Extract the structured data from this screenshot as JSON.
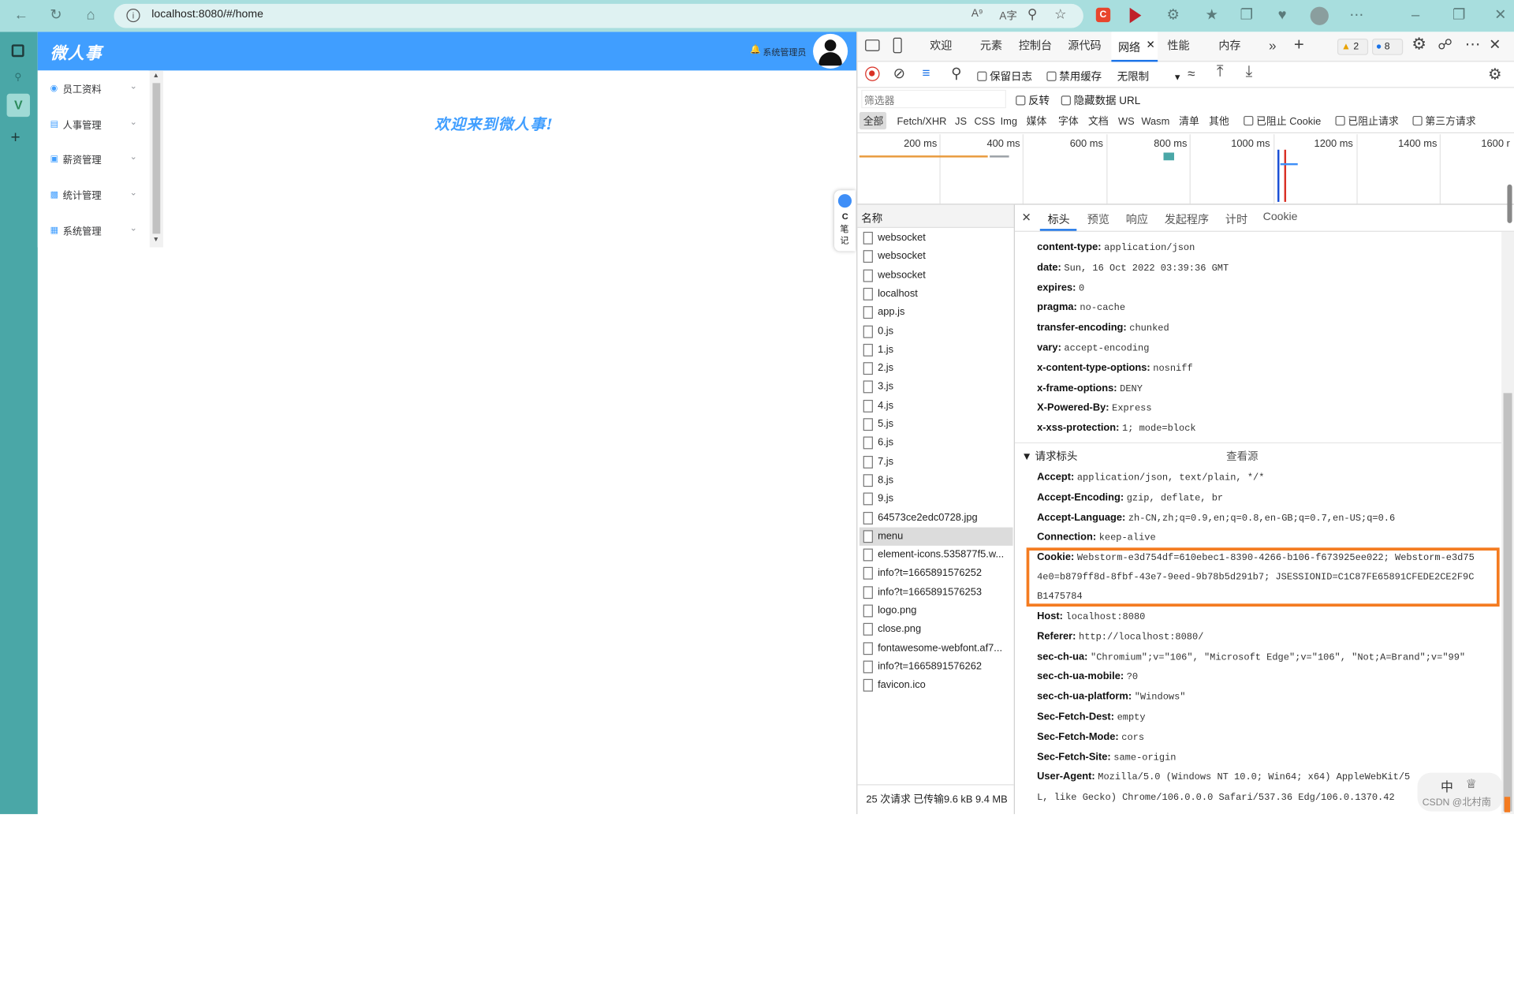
{
  "browser": {
    "url": "localhost:8080/#/home",
    "reader_label": "A⁹",
    "translate_label": "A字",
    "ext_c_label": "C"
  },
  "app": {
    "logo": "微人事",
    "user_name": "系统管理员",
    "welcome": "欢迎来到微人事!",
    "menu": [
      {
        "label": "员工资料",
        "icon": "user-icon"
      },
      {
        "label": "人事管理",
        "icon": "id-card-icon"
      },
      {
        "label": "薪资管理",
        "icon": "money-icon"
      },
      {
        "label": "统计管理",
        "icon": "bar-chart-icon"
      },
      {
        "label": "系统管理",
        "icon": "windows-icon"
      }
    ],
    "csdn_note": {
      "c": "C",
      "line1": "笔",
      "line2": "记"
    }
  },
  "devtools": {
    "tabs": [
      "欢迎",
      "元素",
      "控制台",
      "源代码",
      "网络",
      "性能",
      "内存"
    ],
    "active_tab": "网络",
    "warnings": "2",
    "messages": "8",
    "toolbar": {
      "preserve_log": "保留日志",
      "disable_cache": "禁用缓存",
      "throttle": "无限制"
    },
    "filter": {
      "placeholder": "筛选器",
      "invert": "反转",
      "hide_data_url": "隐藏数据 URL"
    },
    "types": [
      "全部",
      "Fetch/XHR",
      "JS",
      "CSS",
      "Img",
      "媒体",
      "字体",
      "文档",
      "WS",
      "Wasm",
      "清单",
      "其他"
    ],
    "blocked_cookies": "已阻止 Cookie",
    "blocked_requests": "已阻止请求",
    "third_party": "第三方请求",
    "timeline_labels": [
      "200 ms",
      "400 ms",
      "600 ms",
      "800 ms",
      "1000 ms",
      "1200 ms",
      "1400 ms",
      "1600 r"
    ],
    "name_header": "名称",
    "requests": [
      "websocket",
      "websocket",
      "websocket",
      "localhost",
      "app.js",
      "0.js",
      "1.js",
      "2.js",
      "3.js",
      "4.js",
      "5.js",
      "6.js",
      "7.js",
      "8.js",
      "9.js",
      "64573ce2edc0728.jpg",
      "menu",
      "element-icons.535877f5.w...",
      "info?t=1665891576252",
      "info?t=1665891576253",
      "logo.png",
      "close.png",
      "fontawesome-webfont.af7...",
      "info?t=1665891576262",
      "favicon.ico"
    ],
    "selected_request": "menu",
    "status_bar": "25 次请求  已传输9.6 kB  9.4 MB",
    "detail_tabs": [
      "标头",
      "预览",
      "响应",
      "发起程序",
      "计时",
      "Cookie"
    ],
    "active_detail_tab": "标头",
    "response_headers": [
      {
        "k": "content-type:",
        "v": "application/json"
      },
      {
        "k": "date:",
        "v": "Sun, 16 Oct 2022 03:39:36 GMT"
      },
      {
        "k": "expires:",
        "v": "0"
      },
      {
        "k": "pragma:",
        "v": "no-cache"
      },
      {
        "k": "transfer-encoding:",
        "v": "chunked"
      },
      {
        "k": "vary:",
        "v": "accept-encoding"
      },
      {
        "k": "x-content-type-options:",
        "v": "nosniff"
      },
      {
        "k": "x-frame-options:",
        "v": "DENY"
      },
      {
        "k": "X-Powered-By:",
        "v": "Express"
      },
      {
        "k": "x-xss-protection:",
        "v": "1; mode=block"
      }
    ],
    "request_section": "▼ 请求标头",
    "view_source": "查看源",
    "request_headers_top": [
      {
        "k": "Accept:",
        "v": "application/json, text/plain, */*"
      },
      {
        "k": "Accept-Encoding:",
        "v": "gzip, deflate, br"
      },
      {
        "k": "Accept-Language:",
        "v": "zh-CN,zh;q=0.9,en;q=0.8,en-GB;q=0.7,en-US;q=0.6"
      },
      {
        "k": "Connection:",
        "v": "keep-alive"
      }
    ],
    "cookie": {
      "k": "Cookie:",
      "line1": "Webstorm-e3d754df=610ebec1-8390-4266-b106-f673925ee022; Webstorm-e3d75",
      "line2": "4e0=b879ff8d-8fbf-43e7-9eed-9b78b5d291b7; JSESSIONID=C1C87FE65891CFEDE2CE2F9C",
      "line3": "B1475784"
    },
    "request_headers_bottom": [
      {
        "k": "Host:",
        "v": "localhost:8080"
      },
      {
        "k": "Referer:",
        "v": "http://localhost:8080/"
      },
      {
        "k": "sec-ch-ua:",
        "v": "\"Chromium\";v=\"106\", \"Microsoft Edge\";v=\"106\", \"Not;A=Brand\";v=\"99\""
      },
      {
        "k": "sec-ch-ua-mobile:",
        "v": "?0"
      },
      {
        "k": "sec-ch-ua-platform:",
        "v": "\"Windows\""
      },
      {
        "k": "Sec-Fetch-Dest:",
        "v": "empty"
      },
      {
        "k": "Sec-Fetch-Mode:",
        "v": "cors"
      },
      {
        "k": "Sec-Fetch-Site:",
        "v": "same-origin"
      },
      {
        "k": "User-Agent:",
        "v": "Mozilla/5.0 (Windows NT 10.0; Win64; x64) AppleWebKit/5"
      }
    ],
    "ua_cont": "L, like Gecko) Chrome/106.0.0.0 Safari/537.36 Edg/106.0.1370.42",
    "highlight_color": "#f47b20"
  },
  "watermark": {
    "text": "CSDN @北村南",
    "ime": "中"
  }
}
